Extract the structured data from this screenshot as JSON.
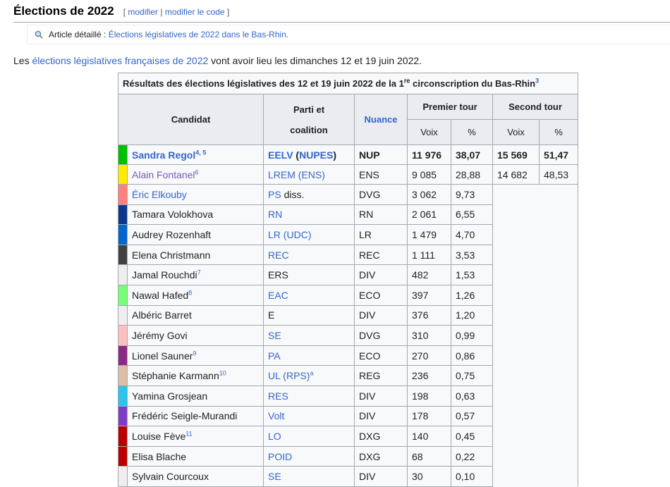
{
  "section": {
    "title": "Élections de 2022",
    "edit_open": "[",
    "edit_label": "modifier",
    "edit_sep": "|",
    "edit_code_label": "modifier le code",
    "edit_close": "]"
  },
  "hatnote": {
    "prefix": "Article détaillé :",
    "link": "Élections législatives de 2022 dans le Bas-Rhin."
  },
  "intro": {
    "before": "Les",
    "link": "élections législatives françaises de 2022",
    "after": "vont avoir lieu les dimanches 12 et 19 juin 2022."
  },
  "table": {
    "title_main": "Résultats des élections législatives des 12 et 19 juin 2022 de la 1",
    "title_sup": "re",
    "title_end": "circonscription du Bas-Rhin",
    "title_ref": "3",
    "headers": {
      "candidat": "Candidat",
      "parti_line1": "Parti et",
      "parti_line2": "coalition",
      "nuance": "Nuance",
      "premier": "Premier tour",
      "second": "Second tour",
      "voix": "Voix",
      "pct": "%"
    },
    "rows": [
      {
        "color": "#00c000",
        "name": "Sandra Regol",
        "ref": "4, 5",
        "party": "EELV",
        "coalition": "NUPES",
        "nuance": "NUP",
        "v1": "11 976",
        "p1": "38,07",
        "v2": "15 569",
        "p2": "51,47"
      },
      {
        "color": "#ffeb00",
        "name": "Alain Fontanel",
        "ref": "6",
        "party": "LREM",
        "coalition": "ENS",
        "nuance": "ENS",
        "v1": "9 085",
        "p1": "28,88",
        "v2": "14 682",
        "p2": "48,53"
      },
      {
        "color": "#ff8080",
        "name": "Éric Elkouby",
        "ref": "",
        "party": "PS",
        "party_suffix": "diss.",
        "nuance": "DVG",
        "v1": "3 062",
        "p1": "9,73"
      },
      {
        "color": "#0d378a",
        "name": "Tamara Volokhova",
        "ref": "",
        "party": "RN",
        "nuance": "RN",
        "v1": "2 061",
        "p1": "6,55"
      },
      {
        "color": "#0066cc",
        "name": "Audrey Rozenhaft",
        "ref": "",
        "party": "LR",
        "coalition": "UDC",
        "nuance": "LR",
        "v1": "1 479",
        "p1": "4,70"
      },
      {
        "color": "#404040",
        "name": "Elena Christmann",
        "ref": "",
        "party": "REC",
        "nuance": "REC",
        "v1": "1 111",
        "p1": "3,53"
      },
      {
        "color": "#eeeeee",
        "name": "Jamal Rouchdi",
        "ref": "7",
        "party_plain": "ERS",
        "nuance": "DIV",
        "v1": "482",
        "p1": "1,53"
      },
      {
        "color": "#77ff77",
        "name": "Nawal Hafed",
        "ref": "8",
        "party": "EAC",
        "nuance": "ECO",
        "v1": "397",
        "p1": "1,26"
      },
      {
        "color": "#eeeeee",
        "name": "Albéric Barret",
        "ref": "",
        "party_plain": "E",
        "nuance": "DIV",
        "v1": "376",
        "p1": "1,20"
      },
      {
        "color": "#ffc0c0",
        "name": "Jérémy Govi",
        "ref": "",
        "party": "SE",
        "nuance": "DVG",
        "v1": "310",
        "p1": "0,99"
      },
      {
        "color": "#8b2a86",
        "name": "Lionel Sauner",
        "ref": "9",
        "party": "PA",
        "nuance": "ECO",
        "v1": "270",
        "p1": "0,86"
      },
      {
        "color": "#dcbfa3",
        "name": "Stéphanie Karmann",
        "ref": "10",
        "party": "UL",
        "coalition": "RPS",
        "coalition_ref": "a",
        "nuance": "REG",
        "v1": "236",
        "p1": "0,75"
      },
      {
        "color": "#2ac4ec",
        "name": "Yamina Grosjean",
        "ref": "",
        "party": "RES",
        "nuance": "DIV",
        "v1": "198",
        "p1": "0,63"
      },
      {
        "color": "#7e3cc4",
        "name": "Frédéric Seigle-Murandi",
        "ref": "",
        "party": "Volt",
        "nuance": "DIV",
        "v1": "178",
        "p1": "0,57"
      },
      {
        "color": "#bb0000",
        "name": "Louise Fève",
        "ref": "11",
        "party": "LO",
        "nuance": "DXG",
        "v1": "140",
        "p1": "0,45"
      },
      {
        "color": "#bb0000",
        "name": "Elisa Blache",
        "ref": "",
        "party": "POID",
        "nuance": "DXG",
        "v1": "68",
        "p1": "0,22"
      },
      {
        "color": "#eeeeee",
        "name": "Sylvain Courcoux",
        "ref": "",
        "party": "SE",
        "nuance": "DIV",
        "v1": "30",
        "p1": "0,10"
      }
    ]
  }
}
